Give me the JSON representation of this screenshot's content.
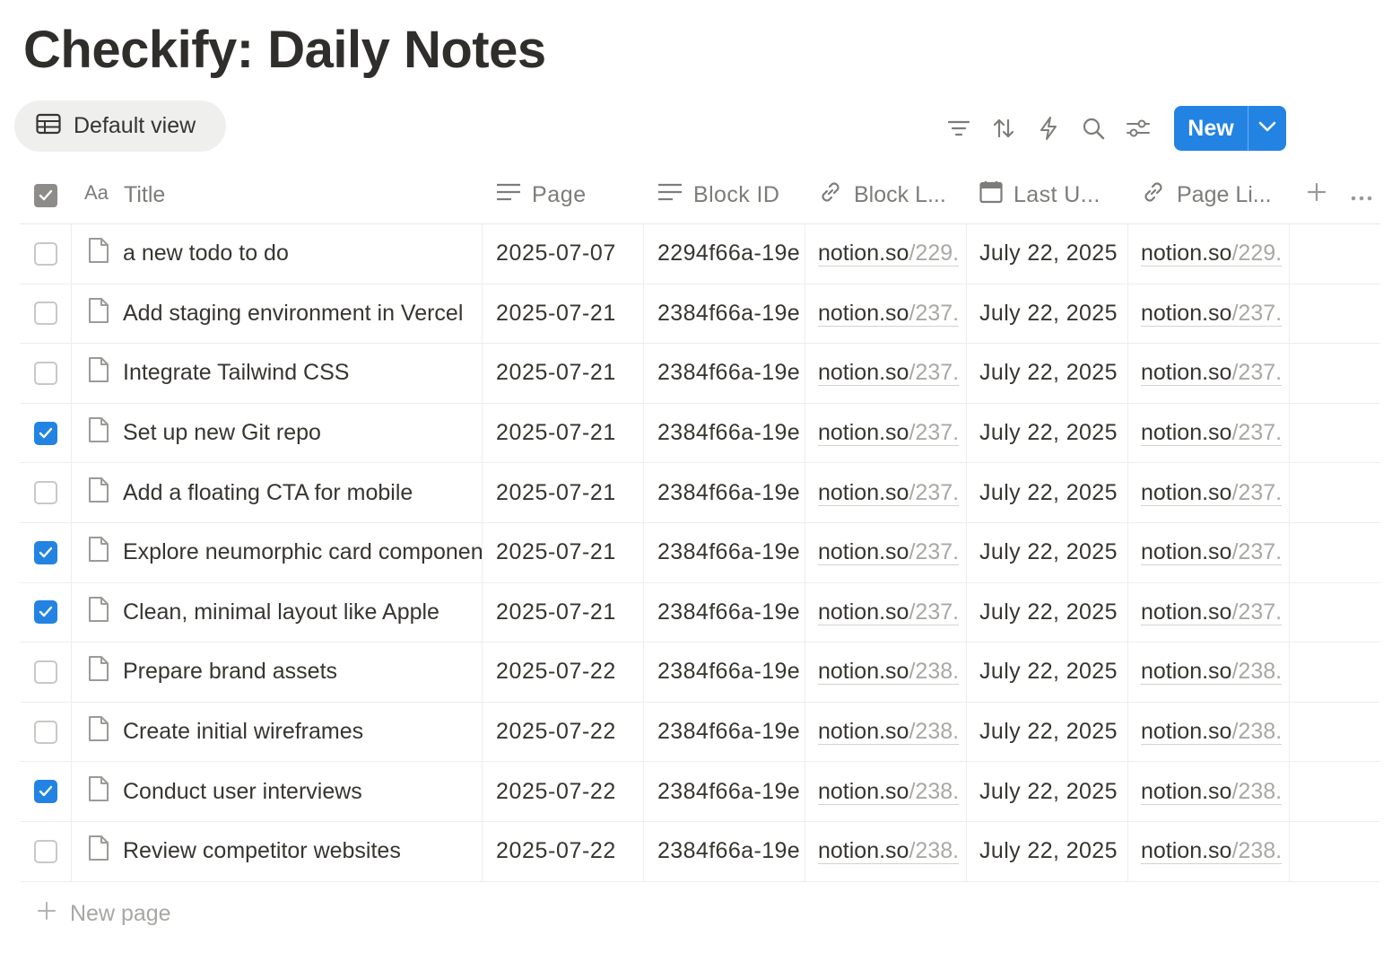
{
  "page": {
    "title": "Checkify: Daily Notes"
  },
  "view": {
    "label": "Default view",
    "icon": "table-icon"
  },
  "toolbar": {
    "icons": [
      "filter-icon",
      "sort-icon",
      "lightning-icon",
      "search-icon",
      "settings-sliders-icon"
    ],
    "new_label": "New"
  },
  "columns": {
    "title": "Title",
    "page": "Page",
    "block_id": "Block ID",
    "block_link": "Block L...",
    "last_updated": "Last U...",
    "page_link": "Page Li..."
  },
  "rows": [
    {
      "checked": false,
      "title": "a new todo to do",
      "page": "2025-07-07",
      "block_id": "2294f66a-19e",
      "block_link_host": "notion.so",
      "block_link_path": "/229.",
      "last_updated": "July 22, 2025",
      "page_link_host": "notion.so",
      "page_link_path": "/229."
    },
    {
      "checked": false,
      "title": "Add staging environment in Vercel",
      "page": "2025-07-21",
      "block_id": "2384f66a-19e",
      "block_link_host": "notion.so",
      "block_link_path": "/237.",
      "last_updated": "July 22, 2025",
      "page_link_host": "notion.so",
      "page_link_path": "/237."
    },
    {
      "checked": false,
      "title": "Integrate Tailwind CSS",
      "page": "2025-07-21",
      "block_id": "2384f66a-19e",
      "block_link_host": "notion.so",
      "block_link_path": "/237.",
      "last_updated": "July 22, 2025",
      "page_link_host": "notion.so",
      "page_link_path": "/237."
    },
    {
      "checked": true,
      "title": "Set up new Git repo",
      "page": "2025-07-21",
      "block_id": "2384f66a-19e",
      "block_link_host": "notion.so",
      "block_link_path": "/237.",
      "last_updated": "July 22, 2025",
      "page_link_host": "notion.so",
      "page_link_path": "/237."
    },
    {
      "checked": false,
      "title": "Add a floating CTA for mobile",
      "page": "2025-07-21",
      "block_id": "2384f66a-19e",
      "block_link_host": "notion.so",
      "block_link_path": "/237.",
      "last_updated": "July 22, 2025",
      "page_link_host": "notion.so",
      "page_link_path": "/237."
    },
    {
      "checked": true,
      "title": "Explore neumorphic card components",
      "page": "2025-07-21",
      "block_id": "2384f66a-19e",
      "block_link_host": "notion.so",
      "block_link_path": "/237.",
      "last_updated": "July 22, 2025",
      "page_link_host": "notion.so",
      "page_link_path": "/237."
    },
    {
      "checked": true,
      "title": "Clean, minimal layout like Apple",
      "page": "2025-07-21",
      "block_id": "2384f66a-19e",
      "block_link_host": "notion.so",
      "block_link_path": "/237.",
      "last_updated": "July 22, 2025",
      "page_link_host": "notion.so",
      "page_link_path": "/237."
    },
    {
      "checked": false,
      "title": "Prepare brand assets",
      "page": "2025-07-22",
      "block_id": "2384f66a-19e",
      "block_link_host": "notion.so",
      "block_link_path": "/238.",
      "last_updated": "July 22, 2025",
      "page_link_host": "notion.so",
      "page_link_path": "/238."
    },
    {
      "checked": false,
      "title": "Create initial wireframes",
      "page": "2025-07-22",
      "block_id": "2384f66a-19e",
      "block_link_host": "notion.so",
      "block_link_path": "/238.",
      "last_updated": "July 22, 2025",
      "page_link_host": "notion.so",
      "page_link_path": "/238."
    },
    {
      "checked": true,
      "title": "Conduct user interviews",
      "page": "2025-07-22",
      "block_id": "2384f66a-19e",
      "block_link_host": "notion.so",
      "block_link_path": "/238.",
      "last_updated": "July 22, 2025",
      "page_link_host": "notion.so",
      "page_link_path": "/238."
    },
    {
      "checked": false,
      "title": "Review competitor websites",
      "page": "2025-07-22",
      "block_id": "2384f66a-19e",
      "block_link_host": "notion.so",
      "block_link_path": "/238.",
      "last_updated": "July 22, 2025",
      "page_link_host": "notion.so",
      "page_link_path": "/238."
    }
  ],
  "footer": {
    "new_page_label": "New page"
  },
  "colors": {
    "accent": "#2383e2",
    "text": "#37352f",
    "muted": "#7d7c78"
  }
}
